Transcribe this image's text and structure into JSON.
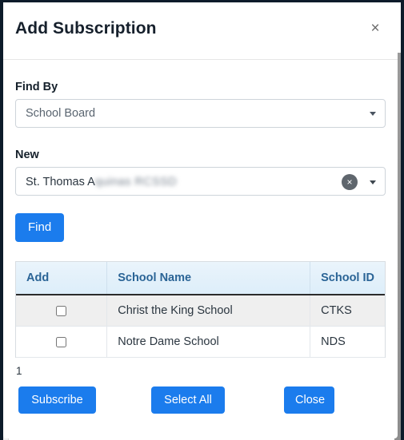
{
  "dialog": {
    "title": "Add Subscription",
    "close_icon_label": "×"
  },
  "form": {
    "find_by": {
      "label": "Find By",
      "value": "School Board",
      "options": [
        "School Board"
      ],
      "caret_icon": "chevron-down-icon"
    },
    "new_field": {
      "label": "New",
      "value_visible": "St. Thomas A",
      "value_redacted": "quinas RCSSD",
      "clear_icon": "×",
      "caret_icon": "chevron-down-icon"
    },
    "find_button": "Find"
  },
  "table": {
    "columns": [
      "Add",
      "School Name",
      "School ID"
    ],
    "rows": [
      {
        "checked": false,
        "name": "Christ the King School",
        "id": "CTKS"
      },
      {
        "checked": false,
        "name": "Notre Dame School",
        "id": "NDS"
      }
    ]
  },
  "pager": {
    "current_page": "1"
  },
  "footer": {
    "subscribe_label": "Subscribe",
    "select_all_label": "Select All",
    "close_label": "Close"
  },
  "colors": {
    "primary_button": "#1b7ced",
    "table_header_text": "#2a6496",
    "table_header_bg": "#e4f0fa",
    "title_text": "#16202c"
  }
}
